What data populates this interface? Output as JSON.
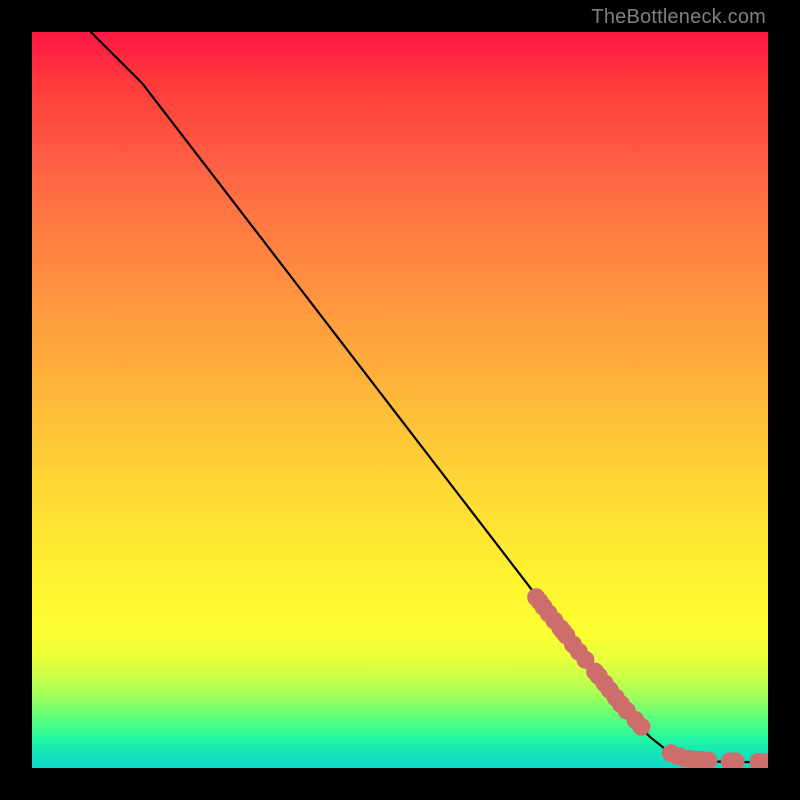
{
  "watermark": "TheBottleneck.com",
  "chart_data": {
    "type": "line",
    "title": "",
    "xlabel": "",
    "ylabel": "",
    "xlim": [
      0,
      100
    ],
    "ylim": [
      0,
      100
    ],
    "grid": false,
    "background": "rainbow-gradient-vertical",
    "series": [
      {
        "name": "bottleneck-curve",
        "color": "#000000",
        "x": [
          8,
          10,
          12,
          15,
          20,
          25,
          30,
          35,
          40,
          45,
          50,
          55,
          60,
          65,
          70,
          72,
          74,
          76,
          78,
          80,
          82,
          84,
          86,
          88,
          90,
          92,
          94,
          96,
          98,
          100
        ],
        "y": [
          100,
          98,
          96,
          93,
          86.5,
          80,
          73.5,
          67,
          60.5,
          54,
          47.5,
          41,
          34.5,
          28,
          21.5,
          18.9,
          16.3,
          13.7,
          11.1,
          8.5,
          6.2,
          4.2,
          2.6,
          1.6,
          1.1,
          0.9,
          0.85,
          0.82,
          0.8,
          0.8
        ]
      }
    ],
    "markers": {
      "name": "sample-points",
      "shape": "circle",
      "color": "#cd6e6c",
      "radius_px": 9,
      "x": [
        68.5,
        69.0,
        69.5,
        70.2,
        71.0,
        71.8,
        72.2,
        72.6,
        73.5,
        74.3,
        75.2,
        76.5,
        77.0,
        77.8,
        78.5,
        79.3,
        80.0,
        80.8,
        82.0,
        82.8,
        86.8,
        87.8,
        88.7,
        89.5,
        90.5,
        91.2,
        91.9,
        94.8,
        95.6,
        98.7,
        99.6
      ],
      "y": [
        23.2,
        22.6,
        21.9,
        21.0,
        20.0,
        19.0,
        18.5,
        18.0,
        16.8,
        15.8,
        14.7,
        13.1,
        12.5,
        11.5,
        10.6,
        9.6,
        8.7,
        7.8,
        6.5,
        5.6,
        2.0,
        1.6,
        1.3,
        1.2,
        1.1,
        1.05,
        1.0,
        0.9,
        0.88,
        0.82,
        0.8
      ]
    }
  }
}
